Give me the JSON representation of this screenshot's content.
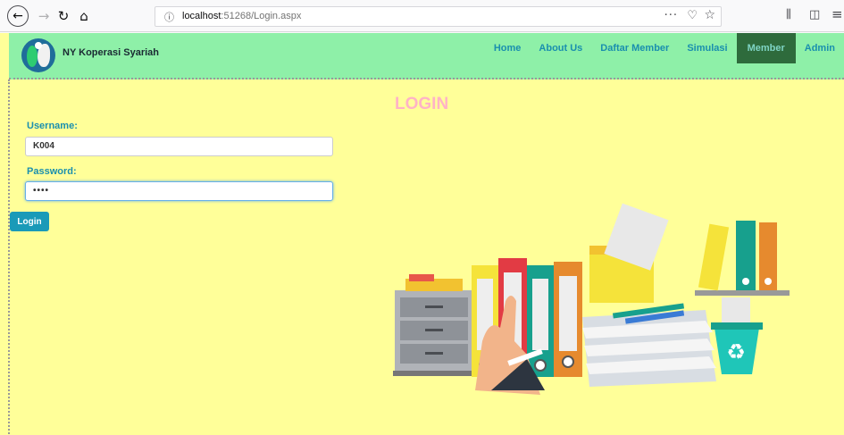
{
  "browser": {
    "back_icon": "arrow-left-icon",
    "forward_icon": "arrow-right-icon",
    "reload_icon": "reload-icon",
    "home_icon": "home-icon",
    "url_host": "localhost",
    "url_rest": ":51268/Login.aspx",
    "more_label": "···"
  },
  "site": {
    "brand": "NY Koperasi Syariah",
    "menu": [
      {
        "label": "Home",
        "active": false
      },
      {
        "label": "About Us",
        "active": false
      },
      {
        "label": "Daftar Member",
        "active": false
      },
      {
        "label": "Simulasi",
        "active": false
      },
      {
        "label": "Member",
        "active": true
      },
      {
        "label": "Admin",
        "active": false
      }
    ]
  },
  "login": {
    "title": "LOGIN",
    "username_label": "Username:",
    "username_value": "K004",
    "password_label": "Password:",
    "password_value": "••••",
    "button_label": "Login"
  },
  "colors": {
    "page_bg": "#ffff99",
    "nav_bg": "#8ef0a8",
    "accent": "#1a8fae",
    "active_menu_bg": "#2e6b3c",
    "title_pink": "#ffb3c6"
  }
}
